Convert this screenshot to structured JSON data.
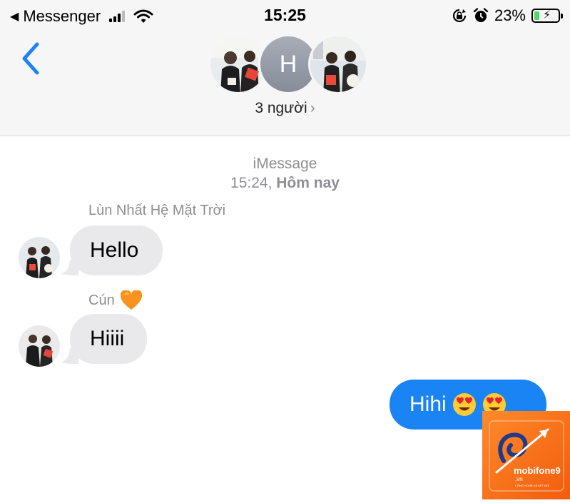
{
  "status_bar": {
    "back_app": "Messenger",
    "time": "15:25",
    "battery_percent": "23%",
    "battery_level": 0.23,
    "icons": [
      "signal-icon",
      "wifi-icon",
      "rotation-lock-icon",
      "alarm-icon",
      "battery-icon"
    ]
  },
  "header": {
    "back_icon": "chevron-left-icon",
    "avatar_initial": "H",
    "member_count": "3 người",
    "member_chevron": "›"
  },
  "thread": {
    "service_name": "iMessage",
    "timestamp_time": "15:24,",
    "timestamp_day": "Hôm nay",
    "messages": [
      {
        "sender": "Lùn Nhất Hệ Mặt Trời",
        "text": "Hello",
        "direction": "incoming"
      },
      {
        "sender": "Cún",
        "sender_emoji": "orange-heart",
        "text": "Hiiii",
        "direction": "incoming"
      },
      {
        "text": "Hihi",
        "emoji": [
          "heart-eyes",
          "heart-eyes"
        ],
        "direction": "outgoing"
      }
    ]
  },
  "colors": {
    "accent_blue": "#1a84f5",
    "incoming_bubble": "#e9e9eb",
    "secondary_text": "#8e8e93",
    "header_bg": "#f6f6f6",
    "battery_green": "#4cd964",
    "watermark_orange": "#f25c0d"
  },
  "watermark": {
    "brand": "mobifone9",
    "domain": ".vn",
    "tagline": "CÔNG NGHỆ VÀ KẾT NỐI"
  }
}
